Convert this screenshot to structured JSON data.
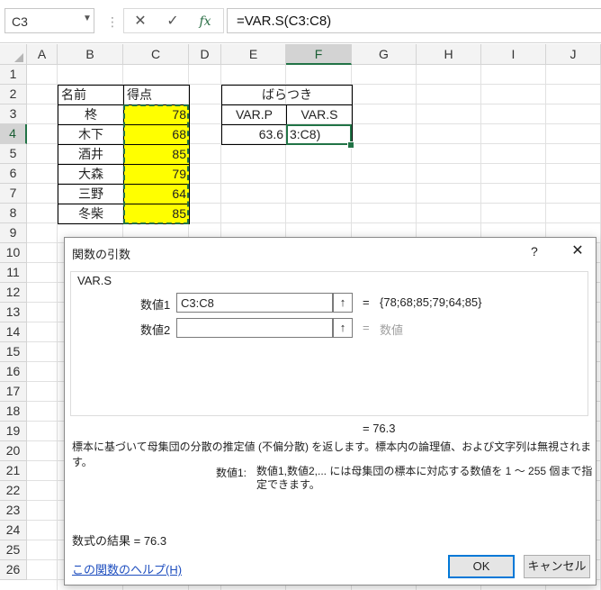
{
  "formula_bar": {
    "name_box": "C3",
    "cancel_icon": "✕",
    "enter_icon": "✓",
    "fx_label": "fx",
    "formula": "=VAR.S(C3:C8)"
  },
  "columns": [
    "A",
    "B",
    "C",
    "D",
    "E",
    "F",
    "G",
    "H",
    "I",
    "J"
  ],
  "rows": [
    "1",
    "2",
    "3",
    "4",
    "5",
    "6",
    "7",
    "8",
    "9",
    "10",
    "11",
    "12",
    "13",
    "14",
    "15",
    "16",
    "17",
    "18",
    "19",
    "20",
    "21",
    "22",
    "23",
    "24",
    "25",
    "26"
  ],
  "table": {
    "header_name": "名前",
    "header_score": "得点",
    "names": [
      "柊",
      "木下",
      "酒井",
      "大森",
      "三野",
      "冬柴"
    ],
    "scores": [
      "78",
      "68",
      "85",
      "79",
      "64",
      "85"
    ]
  },
  "variance_table": {
    "title": "ばらつき",
    "col_p": "VAR.P",
    "col_s": "VAR.S",
    "val_p": "63.6",
    "val_s_edit": "3:C8)"
  },
  "dialog": {
    "title": "関数の引数",
    "help_icon": "?",
    "close_icon": "✕",
    "function_name": "VAR.S",
    "arg1_label": "数値1",
    "arg1_value": "C3:C8",
    "arg1_result": "{78;68;85;79;64;85}",
    "arg2_label": "数値2",
    "arg2_value": "",
    "arg2_hint": "数値",
    "ref_icon": "↑",
    "equals": "=",
    "function_result": "=  76.3",
    "description": "標本に基づいて母集団の分散の推定値 (不偏分散) を返します。標本内の論理値、および文字列は無視されます。",
    "arg_desc_label": "数値1:",
    "arg_desc": "数値1,数値2,... には母集団の標本に対応する数値を 1 ～ 255 個まで指定できます。",
    "formula_result": "数式の結果 =   76.3",
    "help_link": "この関数のヘルプ(H)",
    "ok": "OK",
    "cancel": "キャンセル"
  },
  "colors": {
    "accent": "#217346",
    "highlight": "#ffff00",
    "link": "#1f4fbf"
  }
}
